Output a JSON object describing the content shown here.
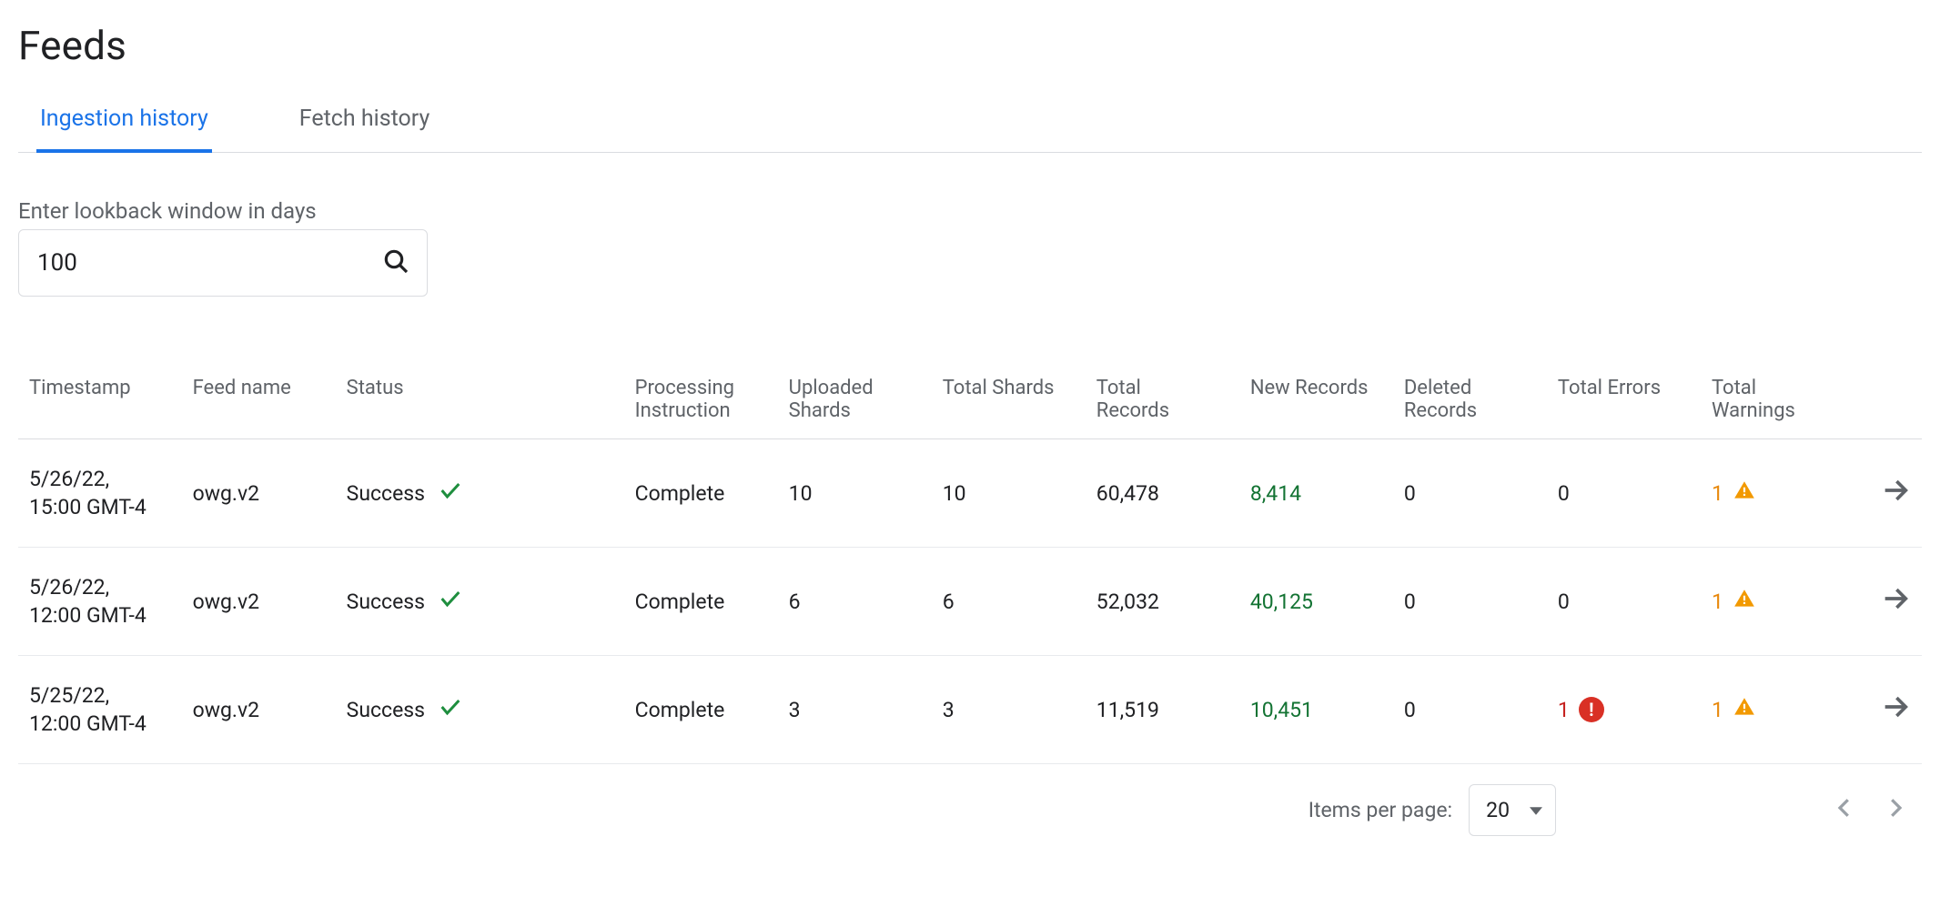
{
  "page_title": "Feeds",
  "tabs": [
    {
      "label": "Ingestion history",
      "active": true
    },
    {
      "label": "Fetch history",
      "active": false
    }
  ],
  "lookback": {
    "label": "Enter lookback window in days",
    "value": "100"
  },
  "columns": [
    "Timestamp",
    "Feed name",
    "Status",
    "Processing Instruction",
    "Uploaded Shards",
    "Total Shards",
    "Total Records",
    "New Records",
    "Deleted Records",
    "Total Errors",
    "Total Warnings"
  ],
  "rows": [
    {
      "timestamp_line1": "5/26/22,",
      "timestamp_line2": "15:00 GMT-4",
      "feed_name": "owg.v2",
      "status": "Success",
      "processing_instruction": "Complete",
      "uploaded_shards": "10",
      "total_shards": "10",
      "total_records": "60,478",
      "new_records": "8,414",
      "deleted_records": "0",
      "total_errors": "0",
      "errors_nonzero": false,
      "total_warnings": "1",
      "warnings_nonzero": true
    },
    {
      "timestamp_line1": "5/26/22,",
      "timestamp_line2": "12:00 GMT-4",
      "feed_name": "owg.v2",
      "status": "Success",
      "processing_instruction": "Complete",
      "uploaded_shards": "6",
      "total_shards": "6",
      "total_records": "52,032",
      "new_records": "40,125",
      "deleted_records": "0",
      "total_errors": "0",
      "errors_nonzero": false,
      "total_warnings": "1",
      "warnings_nonzero": true
    },
    {
      "timestamp_line1": "5/25/22,",
      "timestamp_line2": "12:00 GMT-4",
      "feed_name": "owg.v2",
      "status": "Success",
      "processing_instruction": "Complete",
      "uploaded_shards": "3",
      "total_shards": "3",
      "total_records": "11,519",
      "new_records": "10,451",
      "deleted_records": "0",
      "total_errors": "1",
      "errors_nonzero": true,
      "total_warnings": "1",
      "warnings_nonzero": true
    }
  ],
  "pagination": {
    "items_per_page_label": "Items per page:",
    "page_size": "20"
  }
}
